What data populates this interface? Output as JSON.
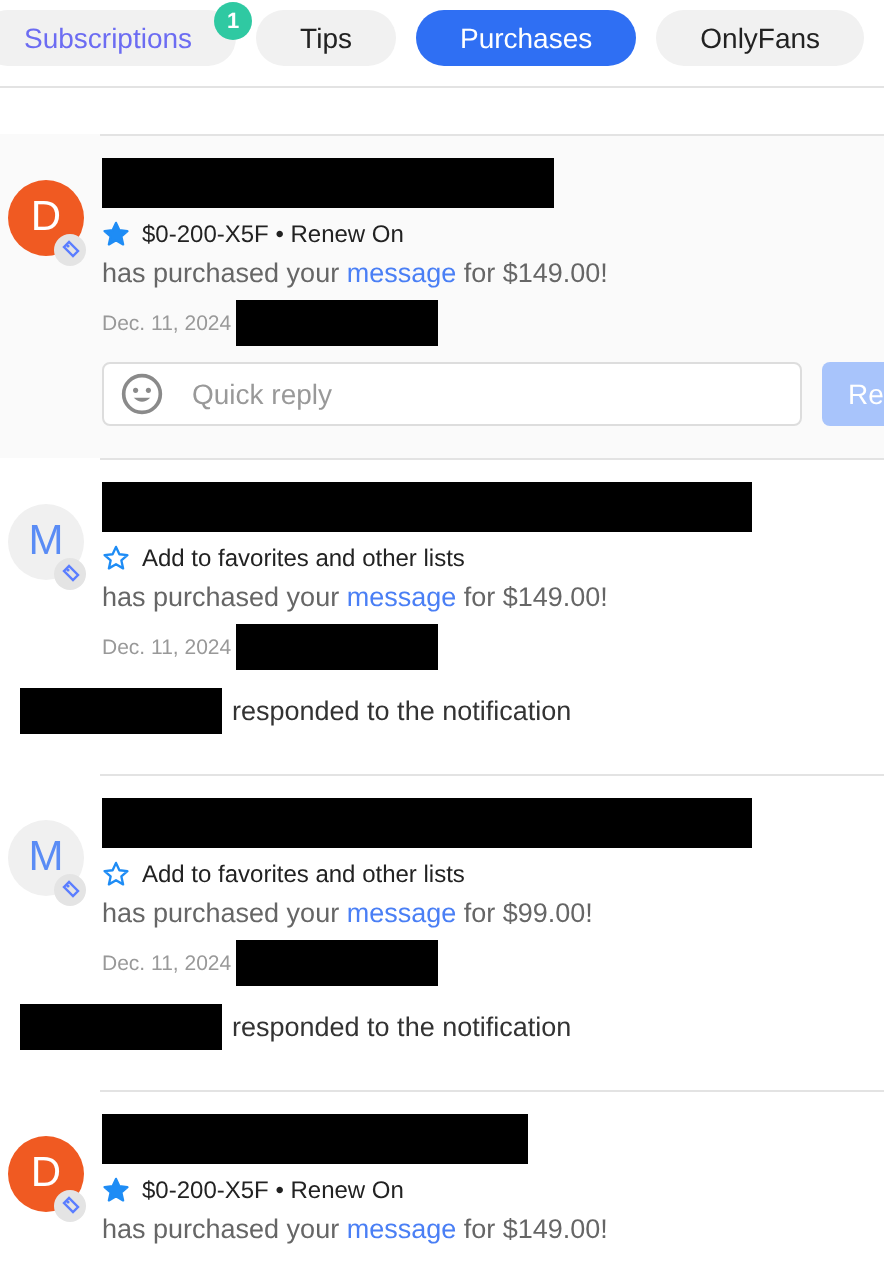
{
  "tabs": [
    {
      "label": "Subscriptions",
      "selected": false,
      "highlighted": true,
      "badge": "1"
    },
    {
      "label": "Tips",
      "selected": false,
      "highlighted": false
    },
    {
      "label": "Purchases",
      "selected": true,
      "highlighted": false
    },
    {
      "label": "OnlyFans",
      "selected": false,
      "highlighted": false
    }
  ],
  "notifications": [
    {
      "avatar": "D",
      "avatar_filled": true,
      "favorite": true,
      "meta": "$0-200-X5F • Renew On",
      "message": {
        "before": "has purchased your ",
        "link": "message",
        "after": " for $149.00!"
      },
      "date": "Dec. 11, 2024",
      "quick_reply": {
        "placeholder": "Quick reply",
        "button": "Re"
      }
    },
    {
      "avatar": "M",
      "avatar_filled": false,
      "favorite": false,
      "meta": "Add to favorites and other lists",
      "message": {
        "before": "has purchased your ",
        "link": "message",
        "after": " for $149.00!"
      },
      "date": "Dec. 11, 2024",
      "response": "responded to the notification"
    },
    {
      "avatar": "M",
      "avatar_filled": false,
      "favorite": false,
      "meta": "Add to favorites and other lists",
      "message": {
        "before": "has purchased your ",
        "link": "message",
        "after": " for $99.00!"
      },
      "date": "Dec. 11, 2024",
      "response": "responded to the notification"
    },
    {
      "avatar": "D",
      "avatar_filled": true,
      "favorite": true,
      "meta": "$0-200-X5F • Renew On",
      "message": {
        "before": "has purchased your ",
        "link": "message",
        "after": " for $149.00!"
      }
    }
  ]
}
